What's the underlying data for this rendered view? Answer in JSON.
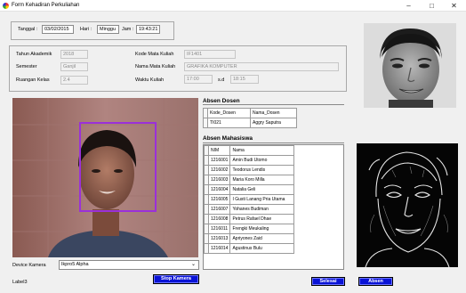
{
  "window": {
    "title": "Form Kehadiran Perkuliahan"
  },
  "header": {
    "tanggal_label": "Tanggal :",
    "tanggal_value": "03/02/2015",
    "hari_label": "Hari :",
    "hari_value": "Minggu",
    "jam_label": "Jam :",
    "jam_value": "19:43:21"
  },
  "info": {
    "tahun_label": "Tahun Akademik",
    "tahun_value": "2018",
    "semester_label": "Semester",
    "semester_value": "Ganjil",
    "ruangan_label": "Ruangan Kelas",
    "ruangan_value": "2.4",
    "kode_label": "Kode Mata Kuliah",
    "kode_value": "IF1401",
    "nama_label": "Nama Mata Kuliah",
    "nama_value": "GRAFIKA KOMPUTER",
    "waktu_label": "Waktu Kuliah",
    "waktu_start": "17:00",
    "waktu_sd": "s.d",
    "waktu_end": "18:15"
  },
  "dosen": {
    "heading": "Absen Dosen",
    "columns": [
      "Kode_Dosen",
      "Nama_Dosen"
    ],
    "rows": [
      [
        "TI021",
        "Aggry Saputra"
      ]
    ]
  },
  "mahasiswa": {
    "heading": "Absen Mahasiswa",
    "columns": [
      "NIM",
      "Nama"
    ],
    "rows": [
      [
        "1216001",
        "Amin Budi Utomo"
      ],
      [
        "1216002",
        "Teodorus Lendis"
      ],
      [
        "1216003",
        "Maria Koro Milla"
      ],
      [
        "1216004",
        "Natalia Geli"
      ],
      [
        "1216005",
        "I Gusti Lanang Pria Utama"
      ],
      [
        "1216007",
        "Yohanes Budiman"
      ],
      [
        "1216008",
        "Petrus Rafael Dhae"
      ],
      [
        "1216011",
        "Frengki Meukaling"
      ],
      [
        "1216013",
        "Apriyones Zaid"
      ],
      [
        "1216014",
        "Agustinus Bulu"
      ]
    ]
  },
  "device": {
    "label": "Device Kamera",
    "value": "Ikpro5 Alpha"
  },
  "status": {
    "label": "Label3"
  },
  "buttons": {
    "stop": "Stop Kamera",
    "selesai": "Selesai",
    "absen": "Absen"
  },
  "colors": {
    "face_box": "#9b30d9",
    "button": "#0a13d6"
  }
}
